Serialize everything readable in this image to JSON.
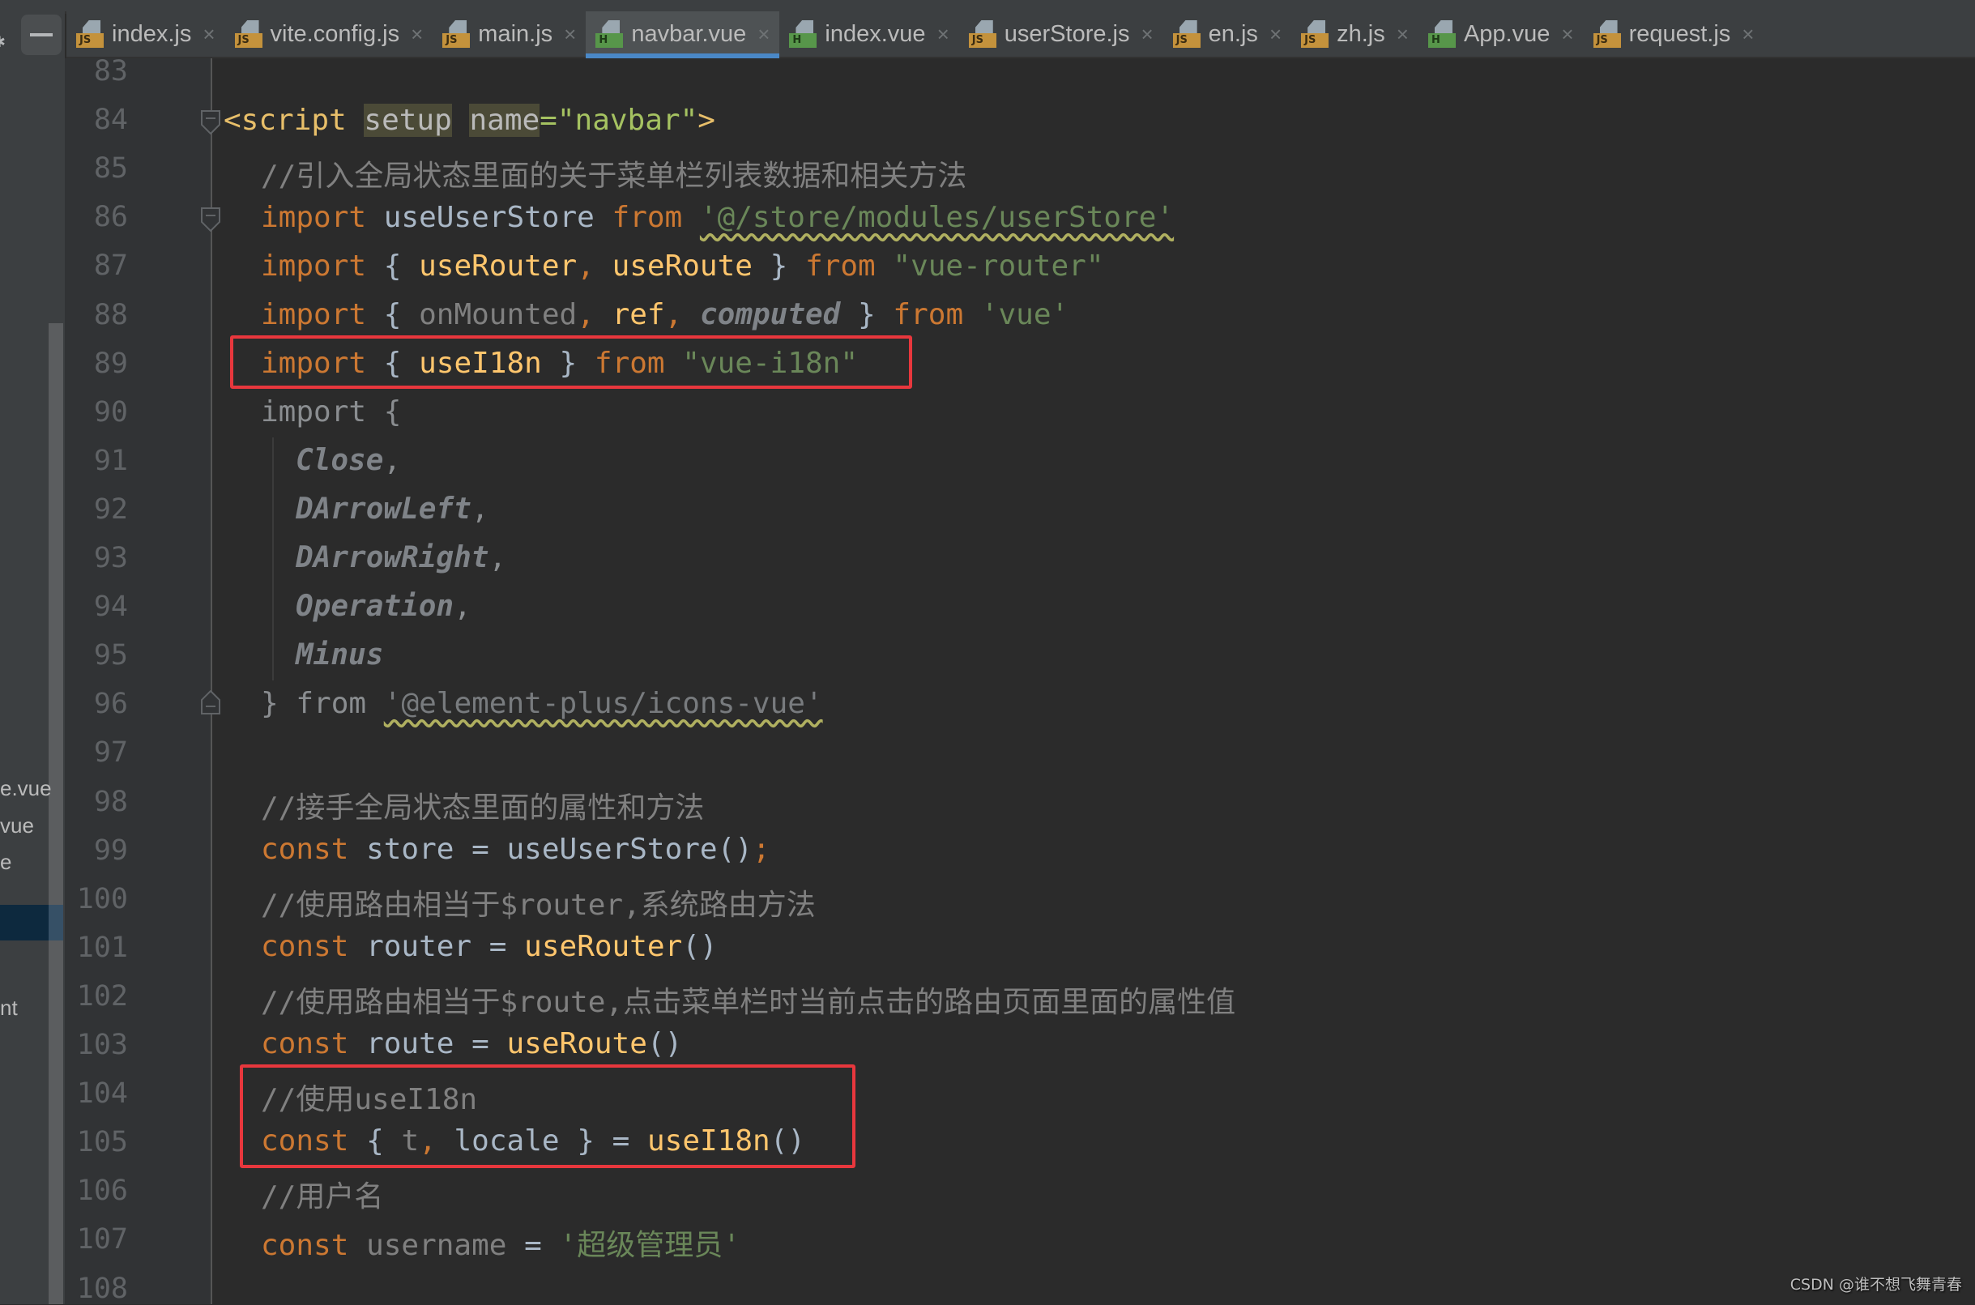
{
  "tabs": [
    {
      "name": "index.js",
      "type": "js",
      "active": false
    },
    {
      "name": "vite.config.js",
      "type": "js",
      "active": false
    },
    {
      "name": "main.js",
      "type": "js",
      "active": false
    },
    {
      "name": "navbar.vue",
      "type": "vue",
      "active": true
    },
    {
      "name": "index.vue",
      "type": "vue",
      "active": false
    },
    {
      "name": "userStore.js",
      "type": "js",
      "active": false
    },
    {
      "name": "en.js",
      "type": "js",
      "active": false
    },
    {
      "name": "zh.js",
      "type": "js",
      "active": false
    },
    {
      "name": "App.vue",
      "type": "vue",
      "active": false
    },
    {
      "name": "request.js",
      "type": "js",
      "active": false
    }
  ],
  "tab_close_glyph": "×",
  "badge_js": "JS",
  "badge_vue": "H",
  "sidebar_fragments": [
    "e.vue",
    "vue",
    "e",
    "nt"
  ],
  "line_numbers": [
    "83",
    "84",
    "85",
    "86",
    "87",
    "88",
    "89",
    "90",
    "91",
    "92",
    "93",
    "94",
    "95",
    "96",
    "97",
    "98",
    "99",
    "100",
    "101",
    "102",
    "103",
    "104",
    "105",
    "106",
    "107",
    "108"
  ],
  "code": {
    "l84": {
      "open": "<script",
      "setup": "setup",
      "name": "name",
      "eq": "=",
      "val": "\"navbar\"",
      "close": ">"
    },
    "l85": "//引入全局状态里面的关于菜单栏列表数据和相关方法",
    "l86": {
      "kw": "import",
      "id": "useUserStore",
      "from": "from",
      "src": "'@/store/modules/userStore'"
    },
    "l87": {
      "kw": "import",
      "ob": "{",
      "a": "useRouter",
      "comma": ",",
      "b": "useRoute",
      "cb": "}",
      "from": "from",
      "src": "\"vue-router\""
    },
    "l88": {
      "kw": "import",
      "ob": "{",
      "a": "onMounted",
      "comma1": ",",
      "b": "ref",
      "comma2": ",",
      "c": "computed",
      "cb": "}",
      "from": "from",
      "src": "'vue'"
    },
    "l89": {
      "kw": "import",
      "ob": "{",
      "a": "useI18n",
      "cb": "}",
      "from": "from",
      "src": "\"vue-i18n\""
    },
    "l90": "import {",
    "l91": {
      "id": "Close",
      "comma": ","
    },
    "l92": {
      "id": "DArrowLeft",
      "comma": ","
    },
    "l93": {
      "id": "DArrowRight",
      "comma": ","
    },
    "l94": {
      "id": "Operation",
      "comma": ","
    },
    "l95": {
      "id": "Minus"
    },
    "l96": {
      "cb": "}",
      "from": "from",
      "src": "'@element-plus/icons-vue'"
    },
    "l98": "//接手全局状态里面的属性和方法",
    "l99": {
      "kw": "const",
      "id": "store",
      "eq": "=",
      "fn": "useUserStore",
      "paren": "()",
      "semi": ";"
    },
    "l100": "//使用路由相当于$router,系统路由方法",
    "l101": {
      "kw": "const",
      "id": "router",
      "eq": "=",
      "fn": "useRouter",
      "paren": "()"
    },
    "l102": "//使用路由相当于$route,点击菜单栏时当前点击的路由页面里面的属性值",
    "l103": {
      "kw": "const",
      "id": "route",
      "eq": "=",
      "fn": "useRoute",
      "paren": "()"
    },
    "l104": "//使用useI18n",
    "l105": {
      "kw": "const",
      "ob": "{",
      "a": "t",
      "comma": ",",
      "b": "locale",
      "cb": "}",
      "eq": "=",
      "fn": "useI18n",
      "paren": "()"
    },
    "l106": "//用户名",
    "l107": {
      "kw": "const",
      "id": "username",
      "eq": "=",
      "str": "'超级管理员'"
    }
  },
  "watermark": "CSDN @谁不想飞舞青春",
  "colors": {
    "editor_bg": "#2b2b2b",
    "keyword": "#cc7832",
    "string": "#6a8759",
    "function": "#ffc66d",
    "comment": "#808080",
    "highlight_box": "#e8373d",
    "active_tab_underline": "#4a88c7"
  }
}
